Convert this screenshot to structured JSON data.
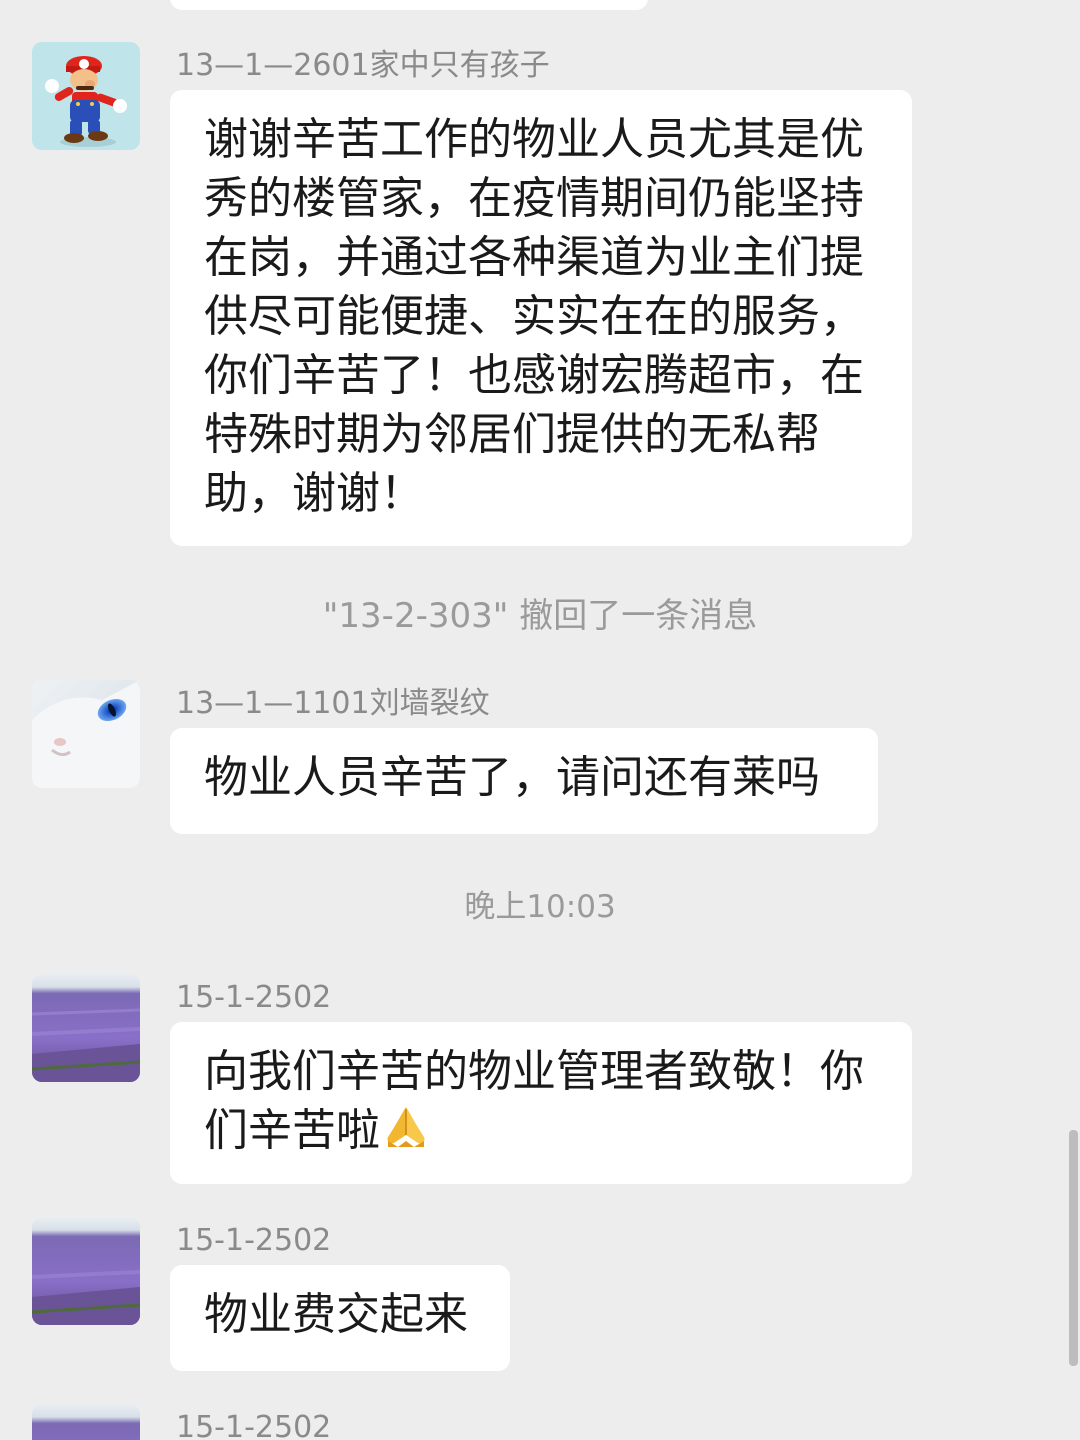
{
  "messages": [
    {
      "sender": "13—1—2601家中只有孩子",
      "avatar": "mario-avatar",
      "text": "谢谢辛苦工作的物业人员尤其是优秀的楼管家，在疫情期间仍能坚持在岗，并通过各种渠道为业主们提供尽可能便捷、实实在在的服务，你们辛苦了！也感谢宏腾超市，在特殊时期为邻居们提供的无私帮助，谢谢！"
    },
    {
      "sender": "13—1—1101刘墙裂纹",
      "avatar": "white-cat-avatar",
      "text": "物业人员辛苦了，请问还有莱吗"
    },
    {
      "sender": "15-1-2502",
      "avatar": "lavender-field-avatar",
      "text": "向我们辛苦的物业管理者致敬！你们辛苦啦",
      "emoji": "praying-hands-icon"
    },
    {
      "sender": "15-1-2502",
      "avatar": "lavender-field-avatar",
      "text": "物业费交起来"
    },
    {
      "sender": "15-1-2502",
      "avatar": "lavender-field-avatar"
    }
  ],
  "system": {
    "recall_notice": "\"13-2-303\" 撤回了一条消息",
    "timestamp": "晚上10:03"
  },
  "colors": {
    "background": "#ededed",
    "bubble": "#ffffff",
    "sender_text": "#8a8a8a",
    "system_text": "#9a9a9a"
  }
}
